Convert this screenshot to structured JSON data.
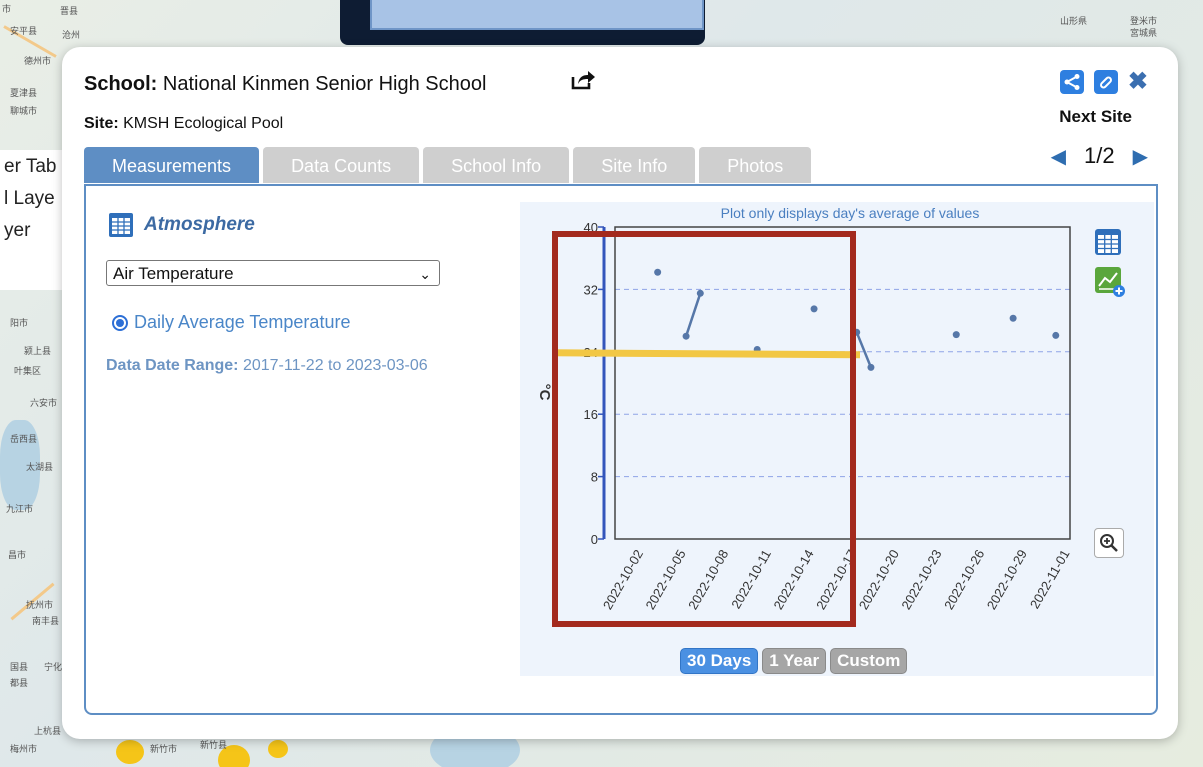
{
  "map": {
    "labels": [
      "市",
      "晋县",
      "安平县",
      "沧州",
      "德州市",
      "夏津县",
      "聊城市",
      "阳市",
      "颍上县",
      "叶集区",
      "六安市",
      "岳西县",
      "太湖县",
      "九江市",
      "昌市",
      "抚州市",
      "南丰县",
      "国县",
      "宁化",
      "都县",
      "上杭县",
      "梅州市",
      "新竹市",
      "新竹县",
      "山形県",
      "登米市",
      "宮城県"
    ]
  },
  "left_panel": {
    "lines": [
      "er Tab",
      "l Laye",
      "yer"
    ]
  },
  "popup": {
    "school_label": "School:",
    "school_name": "National Kinmen Senior High School",
    "site_label": "Site:",
    "site_name": "KMSH Ecological Pool",
    "next_site_label": "Next Site",
    "pager_text": "1/2",
    "tabs": [
      {
        "label": "Measurements",
        "active": true
      },
      {
        "label": "Data Counts",
        "active": false
      },
      {
        "label": "School Info",
        "active": false
      },
      {
        "label": "Site Info",
        "active": false
      },
      {
        "label": "Photos",
        "active": false
      }
    ],
    "category_title": "Atmosphere",
    "select_value": "Air Temperature",
    "radio_label": "Daily Average Temperature",
    "range_label": "Data Date Range:",
    "range_value": "2017-11-22 to 2023-03-06",
    "range_buttons": [
      {
        "label": "30 Days",
        "active": true
      },
      {
        "label": "1 Year",
        "active": false
      },
      {
        "label": "Custom",
        "active": false
      }
    ]
  },
  "colors": {
    "accent": "#5e8ec4",
    "highlight_box": "#a32a1e",
    "yellow_line": "#f2c744"
  },
  "chart_data": {
    "type": "scatter",
    "title": "Plot only displays day's average of values",
    "ylabel": "°C",
    "ylim": [
      0,
      40
    ],
    "yticks": [
      0,
      8,
      16,
      24,
      32,
      40
    ],
    "xticks": [
      "2022-10-02",
      "2022-10-05",
      "2022-10-08",
      "2022-10-11",
      "2022-10-14",
      "2022-10-17",
      "2022-10-20",
      "2022-10-23",
      "2022-10-26",
      "2022-10-29",
      "2022-11-01"
    ],
    "points": [
      {
        "x": "2022-10-03",
        "y": 34.2
      },
      {
        "x": "2022-10-05",
        "y": 26.0
      },
      {
        "x": "2022-10-06",
        "y": 31.5
      },
      {
        "x": "2022-10-10",
        "y": 24.3
      },
      {
        "x": "2022-10-14",
        "y": 29.5
      },
      {
        "x": "2022-10-17",
        "y": 26.5
      },
      {
        "x": "2022-10-18",
        "y": 22.0
      },
      {
        "x": "2022-10-24",
        "y": 26.2
      },
      {
        "x": "2022-10-28",
        "y": 28.3
      },
      {
        "x": "2022-10-31",
        "y": 26.1
      }
    ],
    "segments": [
      [
        {
          "x": "2022-10-05",
          "y": 26.0
        },
        {
          "x": "2022-10-06",
          "y": 31.5
        }
      ],
      [
        {
          "x": "2022-10-17",
          "y": 26.5
        },
        {
          "x": "2022-10-18",
          "y": 22.0
        }
      ]
    ],
    "reference_line": {
      "y": 24,
      "color": "#f2c744"
    },
    "grid": true,
    "xrange_dates": [
      "2022-09-30",
      "2022-11-01"
    ]
  }
}
